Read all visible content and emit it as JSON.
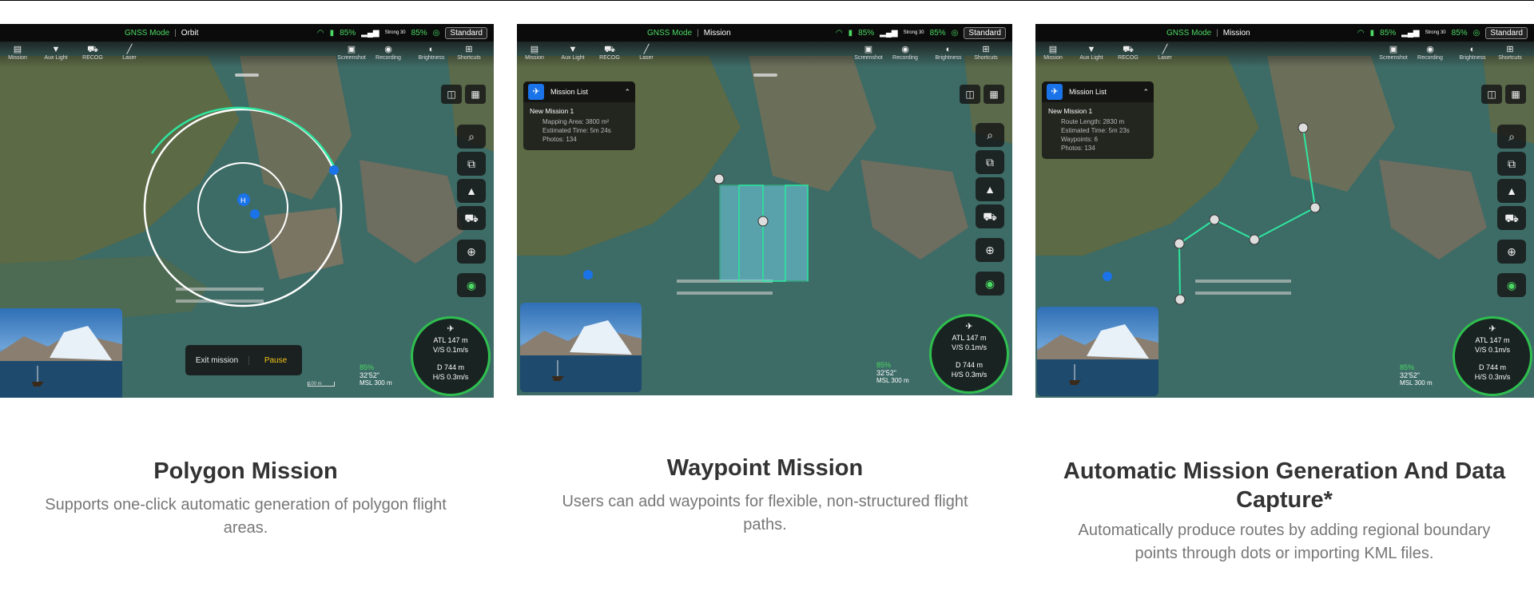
{
  "panels": [
    {
      "status": {
        "mode": "GNSS Mode",
        "task": "Orbit",
        "bat1": "85%",
        "bat2": "85%",
        "strong": "Strong 30",
        "standard": "Standard"
      },
      "toolbar_left": [
        "Mission",
        "Aux Light",
        "RECOG",
        "Laser"
      ],
      "toolbar_right": [
        "Screenshot",
        "Recording",
        "Brightness",
        "Shortcuts"
      ],
      "exit_label": "Exit mission",
      "pause_label": "Pause",
      "scale_label": "100 m",
      "compass": {
        "atl": "ATL 147 m",
        "vs": "V/S 0.1m/s",
        "d": "D 744 m",
        "hs": "H/S 0.3m/s"
      },
      "alt": {
        "pct": "85%",
        "time": "32'52\"",
        "msl": "MSL 300 m"
      }
    },
    {
      "status": {
        "mode": "GNSS Mode",
        "task": "Mission",
        "bat1": "85%",
        "bat2": "85%",
        "strong": "Strong 30",
        "standard": "Standard"
      },
      "toolbar_left": [
        "Mission",
        "Aux Light",
        "RECOG",
        "Laser"
      ],
      "toolbar_right": [
        "Screenshot",
        "Recording",
        "Brightness",
        "Shortcuts"
      ],
      "mission_list": {
        "header": "Mission List",
        "title": "New Mission 1",
        "lines": [
          "Mapping Area: 3800 m²",
          "Estimated Time: 5m 24s",
          "Photos: 134"
        ]
      },
      "compass": {
        "atl": "ATL 147 m",
        "vs": "V/S 0.1m/s",
        "d": "D 744 m",
        "hs": "H/S 0.3m/s"
      },
      "alt": {
        "pct": "85%",
        "time": "32'52\"",
        "msl": "MSL 300 m"
      }
    },
    {
      "status": {
        "mode": "GNSS Mode",
        "task": "Mission",
        "bat1": "85%",
        "bat2": "85%",
        "strong": "Strong 30",
        "standard": "Standard"
      },
      "toolbar_left": [
        "Mission",
        "Aux Light",
        "RECOG",
        "Laser"
      ],
      "toolbar_right": [
        "Screenshot",
        "Recording",
        "Brightness",
        "Shortcuts"
      ],
      "mission_list": {
        "header": "Mission List",
        "title": "New Mission 1",
        "lines": [
          "Route Length: 2830 m",
          "Estimated Time: 5m 23s",
          "Waypoints: 6",
          "Photos: 134"
        ]
      },
      "compass": {
        "atl": "ATL 147 m",
        "vs": "V/S 0.1m/s",
        "d": "D 744 m",
        "hs": "H/S 0.3m/s"
      },
      "alt": {
        "pct": "85%",
        "time": "32'52\"",
        "msl": "MSL 300 m"
      }
    }
  ],
  "captions": [
    {
      "title": "Polygon Mission",
      "desc": "Supports one-click automatic generation of polygon flight areas."
    },
    {
      "title": "Waypoint Mission",
      "desc": "Users can add waypoints for flexible, non-structured flight paths."
    },
    {
      "title": "Automatic Mission Generation And Data Capture*",
      "desc": "Automatically produce routes by adding regional boundary points through dots or importing KML files."
    }
  ],
  "colors": {
    "accent_green": "#4cd964",
    "route_teal": "#2ee6a0",
    "mission_blue": "#1a73e8"
  },
  "icons": {
    "wifi": "wifi-icon",
    "battery": "battery-icon",
    "signal": "signal-icon",
    "search": "search-icon"
  }
}
